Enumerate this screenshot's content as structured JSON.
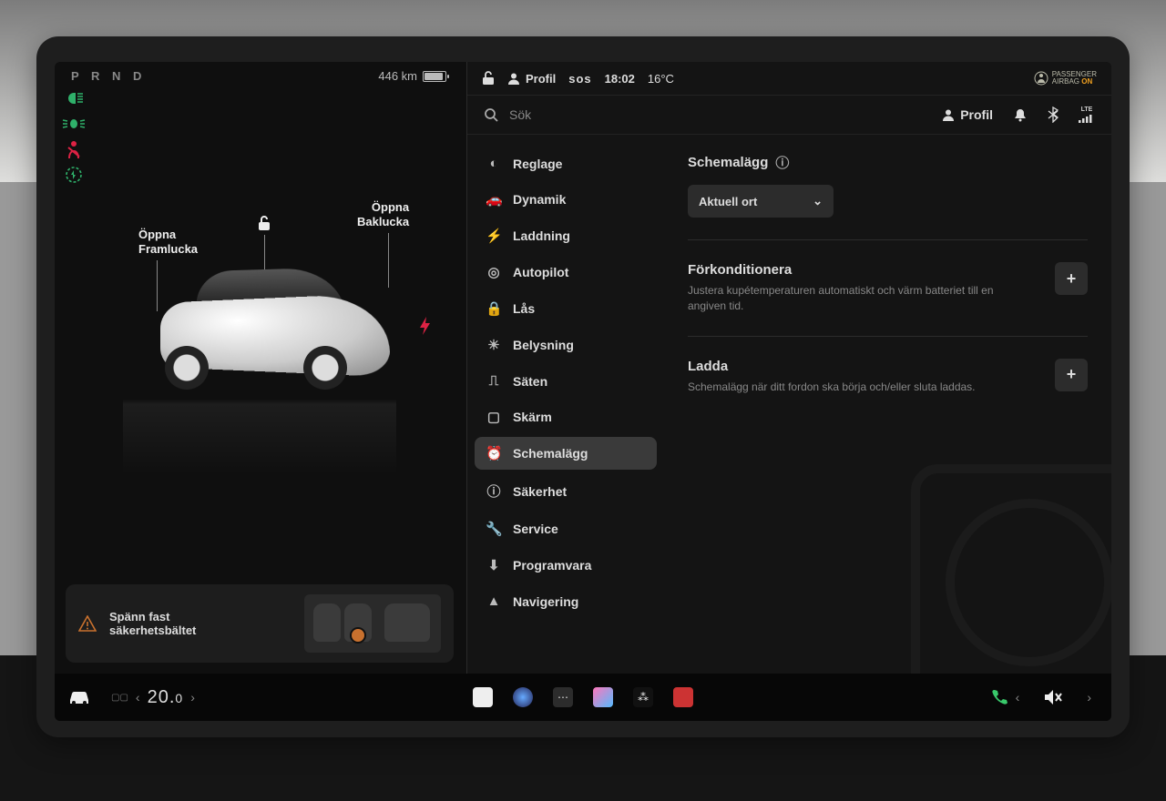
{
  "gear": "P R N D",
  "range": "446 km",
  "callouts": {
    "frunk_l1": "Öppna",
    "frunk_l2": "Framlucka",
    "trunk_l1": "Öppna",
    "trunk_l2": "Baklucka"
  },
  "seatbelt": {
    "line1": "Spänn fast",
    "line2": "säkerhetsbältet"
  },
  "header": {
    "profile": "Profil",
    "sos": "sos",
    "time": "18:02",
    "temp": "16°C",
    "airbag_l1": "PASSENGER",
    "airbag_l2": "AIRBAG",
    "airbag_on": "ON"
  },
  "search": {
    "placeholder": "Sök",
    "profile": "Profil"
  },
  "nav": {
    "reglage": "Reglage",
    "dynamik": "Dynamik",
    "laddning": "Laddning",
    "autopilot": "Autopilot",
    "las": "Lås",
    "belysning": "Belysning",
    "saten": "Säten",
    "skarm": "Skärm",
    "schemalagg": "Schemalägg",
    "sakerhet": "Säkerhet",
    "service": "Service",
    "programvara": "Programvara",
    "navigering": "Navigering"
  },
  "panel": {
    "title": "Schemalägg",
    "dropdown": "Aktuell ort",
    "precond_title": "Förkonditionera",
    "precond_desc": "Justera kupétemperaturen automatiskt och värm batteriet till en angiven tid.",
    "charge_title": "Ladda",
    "charge_desc": "Schemalägg när ditt fordon ska börja och/eller sluta laddas."
  },
  "bottom": {
    "temp_whole": "20.",
    "temp_frac": "0",
    "signal": "LTE"
  }
}
